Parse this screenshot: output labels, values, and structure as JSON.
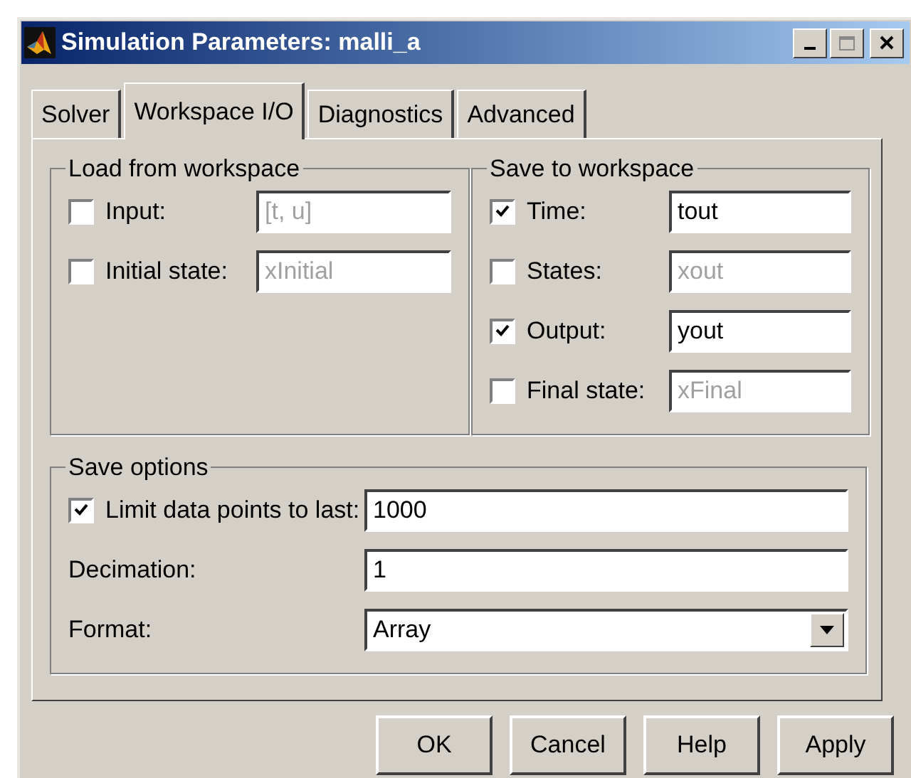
{
  "window": {
    "title": "Simulation Parameters: malli_a"
  },
  "tabs": [
    {
      "label": "Solver",
      "selected": false
    },
    {
      "label": "Workspace I/O",
      "selected": true
    },
    {
      "label": "Diagnostics",
      "selected": false
    },
    {
      "label": "Advanced",
      "selected": false
    }
  ],
  "load_from_workspace": {
    "title": "Load from workspace",
    "rows": [
      {
        "label": "Input:",
        "checked": false,
        "value": "[t, u]"
      },
      {
        "label": "Initial state:",
        "checked": false,
        "value": "xInitial"
      }
    ]
  },
  "save_to_workspace": {
    "title": "Save to workspace",
    "rows": [
      {
        "label": "Time:",
        "checked": true,
        "value": "tout"
      },
      {
        "label": "States:",
        "checked": false,
        "value": "xout"
      },
      {
        "label": "Output:",
        "checked": true,
        "value": "yout"
      },
      {
        "label": "Final state:",
        "checked": false,
        "value": "xFinal"
      }
    ]
  },
  "save_options": {
    "title": "Save options",
    "rows": [
      {
        "kind": "checkbox",
        "label": "Limit data points to last:",
        "checked": true,
        "value": "1000"
      },
      {
        "kind": "text",
        "label": "Decimation:",
        "value": "1"
      },
      {
        "kind": "dropdown",
        "label": "Format:",
        "value": "Array"
      }
    ]
  },
  "buttons": [
    "OK",
    "Cancel",
    "Help",
    "Apply"
  ]
}
